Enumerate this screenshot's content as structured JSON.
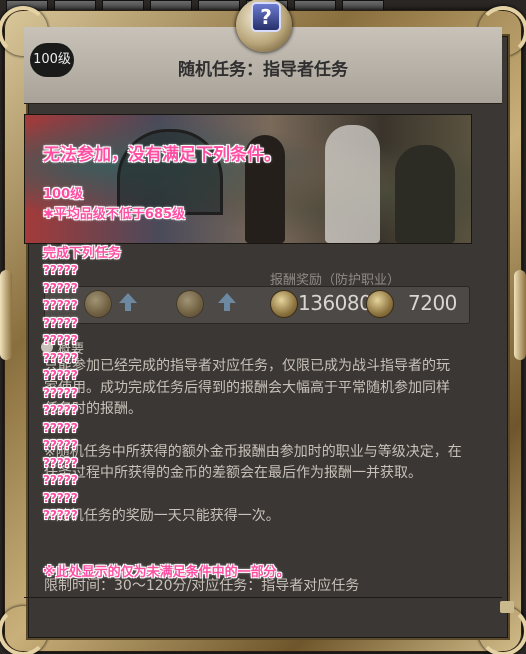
{
  "level_badge": "100级",
  "title": "随机任务：指导者任务",
  "rewards": {
    "label": "报酬奖励（防护职业）",
    "exp": "136080",
    "gil": "7200"
  },
  "sections": {
    "overview_label": "概要"
  },
  "description": [
    "只能参加已经完成的指导者对应任务，仅限已成为战斗指导者的玩家使用。成功完成任务后得到的报酬会大幅高于平常随机参加同样任务时的报酬。",
    "※随机任务中所获得的额外金币报酬由参加时的职业与等级决定，在任务过程中所获得的金币的差额会在最后作为报酬一并获取。",
    "※随机任务的奖励一天只能获得一次。"
  ],
  "footer_partial": "限制时间：30～120分/对应任务：指导者对应任务",
  "overlay": {
    "heading": "无法参加，没有满足下列条件。",
    "cond_level": "100级",
    "cond_ilvl": "✱平均品级不低于685级",
    "quest_header": "完成下列任务",
    "quests": [
      "?????",
      "?????",
      "?????",
      "?????",
      "?????",
      "?????",
      "?????",
      "?????",
      "?????",
      "?????",
      "?????",
      "?????",
      "?????",
      "?????",
      "?????"
    ],
    "note": "※此处显示的仅为未满足条件中的一部分。"
  },
  "colors": {
    "overlay_text": "#ff4fa3",
    "frame_gold": "#c9b07a",
    "panel_bg": "#3b3734"
  },
  "icons": {
    "quest_icon": "question-mark-icon",
    "coin": "gil-coin-icon",
    "exp": "exp-icon",
    "upgrade": "arrow-up-icon"
  }
}
